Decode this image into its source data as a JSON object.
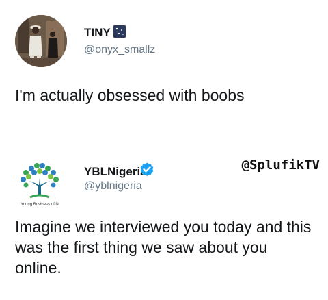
{
  "tweets": [
    {
      "name": "TINY",
      "handle": "@onyx_smallz",
      "text": "I'm actually obsessed with boobs"
    },
    {
      "name": "YBLNigeria",
      "handle": "@yblnigeria",
      "text": "Imagine we interviewed you today and this was the first thing we saw about you online.",
      "logo_text": "Young Business of N"
    }
  ],
  "watermark": "@SplufikTV",
  "colors": {
    "text": "#14171a",
    "handle": "#657786",
    "verified": "#1da1f2",
    "tree_leaf_green": "#3aa655",
    "tree_leaf_blue": "#2f80c1",
    "tree_trunk": "#1c6b8f"
  }
}
